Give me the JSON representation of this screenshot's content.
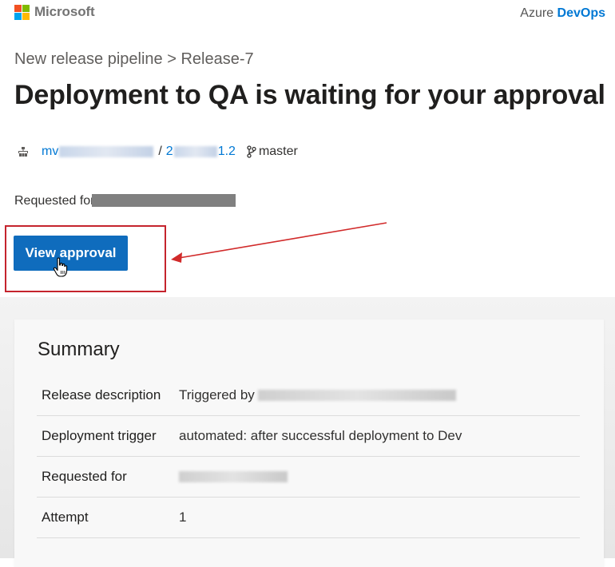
{
  "brand": {
    "microsoft": "Microsoft",
    "logo_colors": [
      "#f25022",
      "#7fba00",
      "#00a4ef",
      "#ffb900"
    ],
    "product_prefix": "Azure",
    "product_name": "DevOps"
  },
  "breadcrumb": {
    "pipeline": "New release pipeline",
    "separator": ">",
    "release": "Release-7"
  },
  "page_title": "Deployment to QA is waiting for your approval",
  "meta": {
    "build_prefix": "mv",
    "separator": "/",
    "version_prefix": "2",
    "version_suffix": "1.2",
    "branch": "master"
  },
  "requested": {
    "label": "Requested for"
  },
  "actions": {
    "view_approval": "View approval"
  },
  "summary": {
    "title": "Summary",
    "rows": [
      {
        "label": "Release description",
        "value": "Triggered by"
      },
      {
        "label": "Deployment trigger",
        "value": "automated: after successful deployment to Dev"
      },
      {
        "label": "Requested for",
        "value": ""
      },
      {
        "label": "Attempt",
        "value": "1"
      }
    ]
  },
  "colors": {
    "accent": "#0078d4",
    "button": "#0f6cbd",
    "annotation_red": "#c5242d"
  }
}
